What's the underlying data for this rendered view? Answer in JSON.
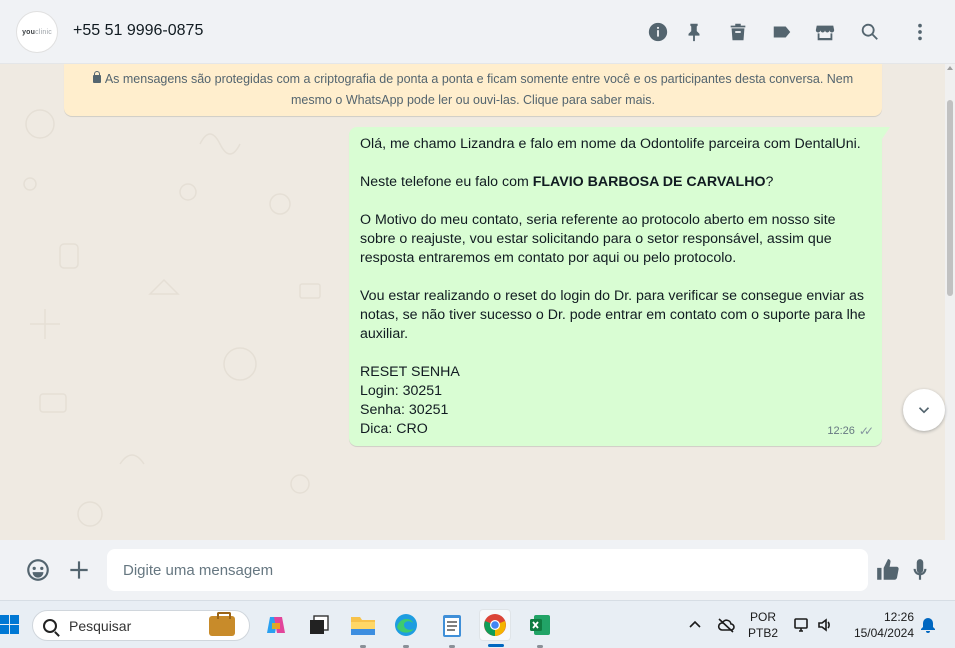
{
  "header": {
    "avatar_text_a": "you",
    "avatar_text_b": "clinic",
    "contact": "+55 51 9996-0875",
    "icons": [
      "info-icon",
      "pin-icon",
      "trash-icon",
      "label-icon",
      "store-icon",
      "search-icon",
      "menu-icon"
    ]
  },
  "notice": {
    "text": "As mensagens são protegidas com a criptografia de ponta a ponta e ficam somente entre você e os participantes desta conversa. Nem mesmo o WhatsApp pode ler ou ouvi-las. Clique para saber mais."
  },
  "message": {
    "line1": "Olá, me chamo Lizandra e falo em nome da Odontolife parceira com DentalUni.",
    "line2_prefix": "Neste telefone eu falo com ",
    "line2_bold": "FLAVIO BARBOSA DE CARVALHO",
    "line2_suffix": "?",
    "para3": "O Motivo do meu contato, seria referente ao protocolo aberto em nosso site sobre o reajuste, vou estar solicitando para o setor responsável, assim que resposta entraremos em contato por aqui ou pelo protocolo.",
    "para4": "Vou estar realizando o reset do login do Dr. para verificar se consegue enviar as notas, se não tiver sucesso o Dr. pode entrar em contato com o suporte para lhe auxiliar.",
    "reset_title": "RESET SENHA",
    "login": "Login: 30251",
    "senha": "Senha: 30251",
    "dica": "Dica: CRO",
    "time": "12:26"
  },
  "composer": {
    "placeholder": "Digite uma mensagem"
  },
  "taskbar": {
    "search_label": "Pesquisar",
    "lang_top": "POR",
    "lang_bottom": "PTB2",
    "time": "12:26",
    "date": "15/04/2024",
    "apps": [
      "copilot-icon",
      "task-view-icon",
      "file-explorer-icon",
      "edge-icon",
      "notepad-icon",
      "chrome-icon",
      "excel-icon"
    ]
  },
  "colors": {
    "bubble": "#d9fdd3",
    "notice": "#ffeecd",
    "header": "#f0f2f5"
  }
}
